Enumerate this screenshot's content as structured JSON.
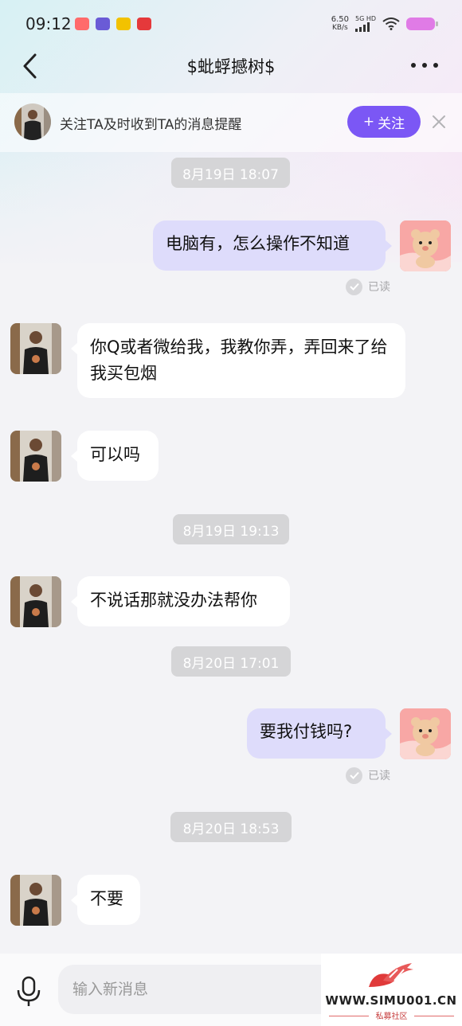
{
  "status_bar": {
    "time": "09:12",
    "net_speed_value": "6.50",
    "net_speed_unit": "KB/s",
    "net_type": "5G HD",
    "battery_color": "#e07be6"
  },
  "header": {
    "title": "$蚍蜉撼树$",
    "back_icon": "chevron-left-icon",
    "more_icon": "more-dots-icon"
  },
  "follow_bar": {
    "text": "关注TA及时收到TA的消息提醒",
    "button_icon": "+",
    "button_label": "关注",
    "button_color": "#7b57f5",
    "close_icon": "close-icon"
  },
  "messages": [
    {
      "type": "timestamp",
      "text": "8月19日 18:07"
    },
    {
      "type": "outgoing",
      "text": "电脑有，怎么操作不知道",
      "status": "已读"
    },
    {
      "type": "incoming",
      "text": "你Q或者微给我，我教你弄，弄回来了给我买包烟"
    },
    {
      "type": "incoming",
      "text": "可以吗"
    },
    {
      "type": "timestamp",
      "text": "8月19日 19:13"
    },
    {
      "type": "incoming",
      "text": "不说话那就没办法帮你"
    },
    {
      "type": "timestamp",
      "text": "8月20日 17:01"
    },
    {
      "type": "outgoing",
      "text": "要我付钱吗?",
      "status": "已读"
    },
    {
      "type": "timestamp",
      "text": "8月20日 18:53"
    },
    {
      "type": "incoming",
      "text": "不要"
    }
  ],
  "input_bar": {
    "placeholder": "输入新消息",
    "mic_icon": "microphone-icon"
  },
  "watermark": {
    "url": "WWW.SIMU001.CN",
    "subtitle": "私募社区"
  },
  "colors": {
    "outgoing_bubble": "#dedcfb",
    "incoming_bubble": "#ffffff",
    "timestamp_bg": "#d5d5d7"
  }
}
